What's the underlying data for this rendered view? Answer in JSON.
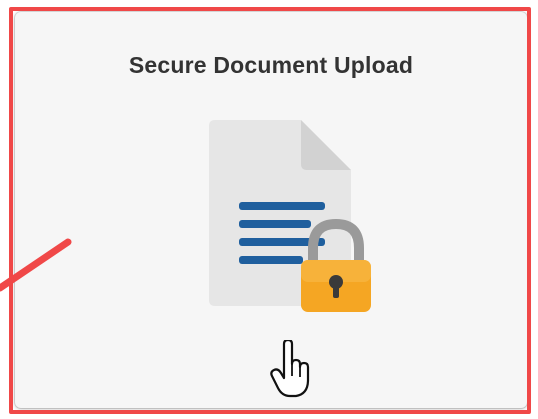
{
  "tile": {
    "title": "Secure Document Upload",
    "icon": "secure-document-lock-icon"
  },
  "annotations": {
    "highlight_color": "#f04848",
    "arrow_color": "#f04848"
  },
  "cursor": {
    "icon": "hand-pointer-icon"
  },
  "colors": {
    "document_page": "#e6e6e6",
    "document_fold": "#d0d0d0",
    "document_lines": "#1f5f9e",
    "lock_shackle": "#9a9a9a",
    "lock_body": "#f5a623",
    "lock_keyhole": "#3a3a3a"
  }
}
